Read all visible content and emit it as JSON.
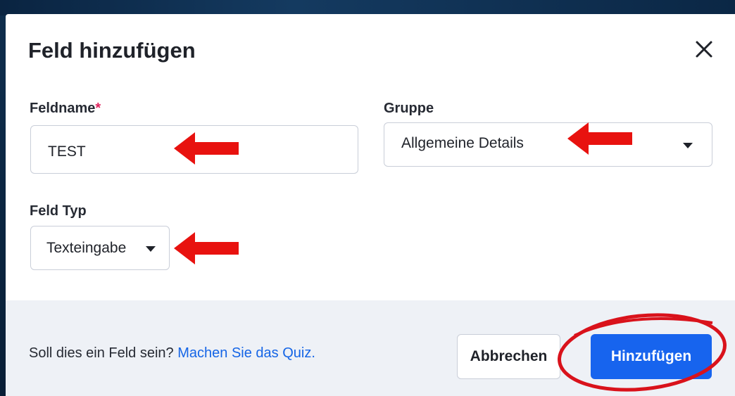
{
  "dialog": {
    "title": "Feld hinzufügen",
    "close_icon": "close-x-icon"
  },
  "fields": {
    "name": {
      "label": "Feldname",
      "required_marker": "*",
      "value": "TEST"
    },
    "group": {
      "label": "Gruppe",
      "selected": "Allgemeine Details",
      "icon": "caret-down-icon"
    },
    "type": {
      "label": "Feld Typ",
      "selected": "Texteingabe",
      "icon": "caret-down-icon"
    }
  },
  "footer": {
    "question": "Soll dies ein Feld sein? ",
    "quiz_link": "Machen Sie das Quiz.",
    "cancel_label": "Abbrechen",
    "add_label": "Hinzufügen"
  },
  "annotations": {
    "arrow_color": "#e8120f",
    "ring_color": "#d9121b",
    "arrows": [
      "arrow-left-icon",
      "arrow-left-icon",
      "arrow-left-icon"
    ],
    "ring": "highlight-ellipse"
  },
  "colors": {
    "primary": "#1764ee",
    "link": "#1565e6",
    "required": "#e0245e",
    "footer_bg": "#eef1f6",
    "backdrop": "#0b2642"
  }
}
